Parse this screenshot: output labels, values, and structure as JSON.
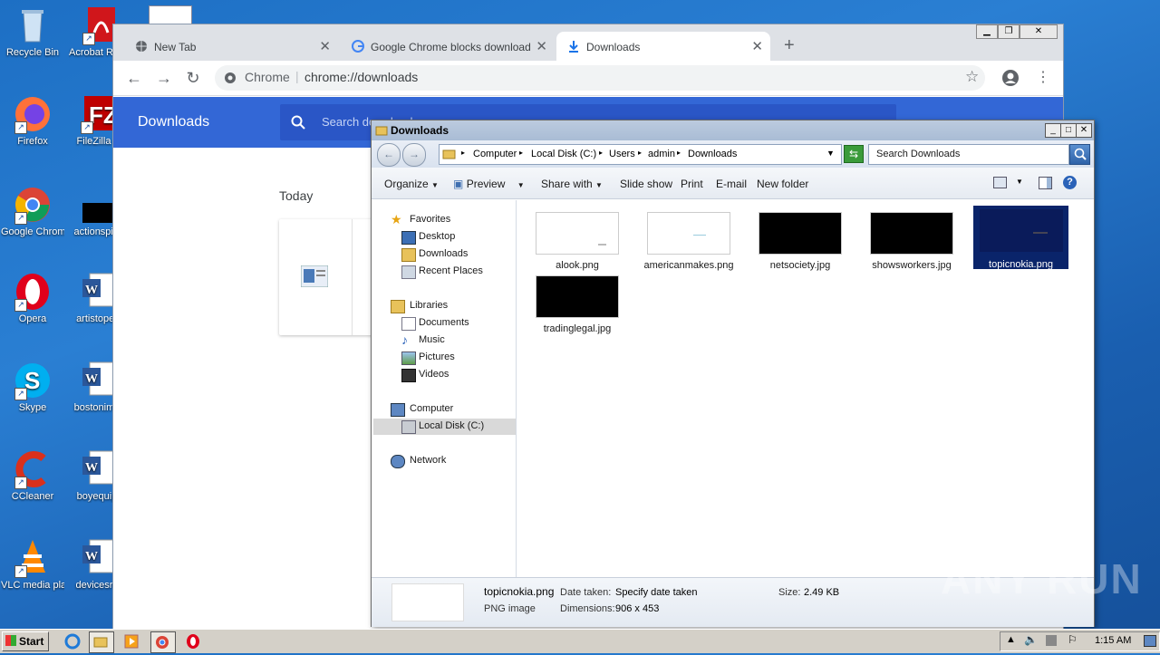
{
  "desktop": {
    "icons": [
      {
        "label": "Recycle Bin"
      },
      {
        "label": "Acrobat Reader"
      },
      {
        "label": "Firefox"
      },
      {
        "label": "FileZilla C"
      },
      {
        "label": "Google Chrome"
      },
      {
        "label": "actionspir"
      },
      {
        "label": "Opera"
      },
      {
        "label": "artistoper"
      },
      {
        "label": "Skype"
      },
      {
        "label": "bostonimp"
      },
      {
        "label": "CCleaner"
      },
      {
        "label": "boyequip"
      },
      {
        "label": "VLC media player"
      },
      {
        "label": "devicesre"
      }
    ]
  },
  "chrome": {
    "tabs": [
      {
        "title": "New Tab"
      },
      {
        "title": "Google Chrome blocks downloads - G"
      },
      {
        "title": "Downloads"
      }
    ],
    "omnibox": {
      "scheme_label": "Chrome",
      "url": "chrome://downloads"
    },
    "downloads": {
      "header_title": "Downloads",
      "search_placeholder": "Search downloads",
      "section_label": "Today"
    }
  },
  "explorer": {
    "title": "Downloads",
    "breadcrumb": [
      "Computer",
      "Local Disk (C:)",
      "Users",
      "admin",
      "Downloads"
    ],
    "search_placeholder": "Search Downloads",
    "commands": [
      "Organize",
      "Preview",
      "Share with",
      "Slide show",
      "Print",
      "E-mail",
      "New folder"
    ],
    "nav": {
      "favorites": "Favorites",
      "favorites_items": [
        "Desktop",
        "Downloads",
        "Recent Places"
      ],
      "libraries": "Libraries",
      "libraries_items": [
        "Documents",
        "Music",
        "Pictures",
        "Videos"
      ],
      "computer": "Computer",
      "computer_items": [
        "Local Disk (C:)"
      ],
      "network": "Network"
    },
    "files": [
      {
        "name": "alook.png",
        "preview": "light"
      },
      {
        "name": "americanmakes.png",
        "preview": "light"
      },
      {
        "name": "netsociety.jpg",
        "preview": "dark"
      },
      {
        "name": "showsworkers.jpg",
        "preview": "dark"
      },
      {
        "name": "topicnokia.png",
        "preview": "dark",
        "selected": true
      },
      {
        "name": "tradinglegal.jpg",
        "preview": "dark"
      }
    ],
    "details": {
      "file_name": "topicnokia.png",
      "file_type": "PNG image",
      "date_taken_label": "Date taken:",
      "date_taken_value": "Specify date taken",
      "dimensions_label": "Dimensions:",
      "dimensions_value": "906 x 453",
      "size_label": "Size:",
      "size_value": "2.49 KB"
    }
  },
  "taskbar": {
    "start_label": "Start",
    "clock": "1:15 AM"
  },
  "watermark": "ANY RUN",
  "colors": {
    "chrome_blue": "#3367d6",
    "desktop_blue": "#2a7fd3",
    "selection": "#0a246a"
  }
}
